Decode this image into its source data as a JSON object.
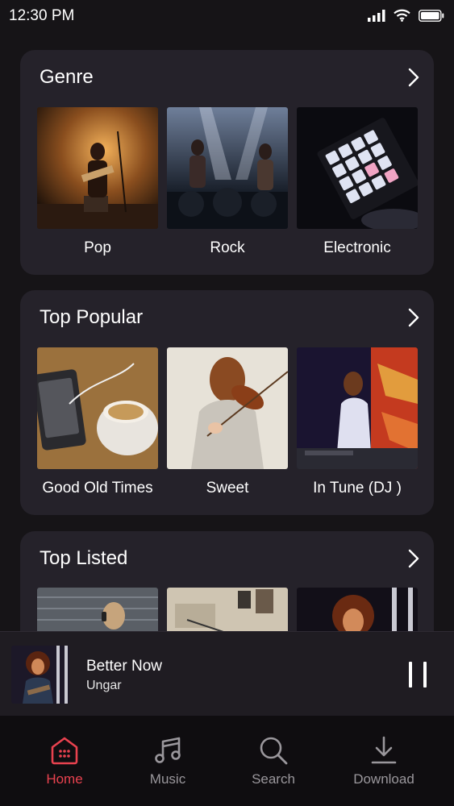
{
  "status_bar": {
    "time": "12:30 PM"
  },
  "sections": [
    {
      "title": "Genre",
      "items": [
        {
          "label": "Pop"
        },
        {
          "label": "Rock"
        },
        {
          "label": "Electronic"
        }
      ]
    },
    {
      "title": "Top Popular",
      "items": [
        {
          "label": "Good Old Times"
        },
        {
          "label": "Sweet"
        },
        {
          "label": "In Tune (DJ )"
        }
      ]
    },
    {
      "title": "Top Listed",
      "items": [
        {
          "label": ""
        },
        {
          "label": ""
        },
        {
          "label": ""
        }
      ]
    }
  ],
  "now_playing": {
    "title": "Better Now",
    "artist": "Ungar"
  },
  "nav": {
    "items": [
      {
        "label": "Home",
        "icon": "home-icon",
        "active": true
      },
      {
        "label": "Music",
        "icon": "music-note-icon",
        "active": false
      },
      {
        "label": "Search",
        "icon": "search-icon",
        "active": false
      },
      {
        "label": "Download",
        "icon": "download-icon",
        "active": false
      }
    ]
  },
  "colors": {
    "accent": "#e9424f",
    "background": "#161417",
    "card": "#25222a",
    "nav_inactive": "#9a979c"
  }
}
